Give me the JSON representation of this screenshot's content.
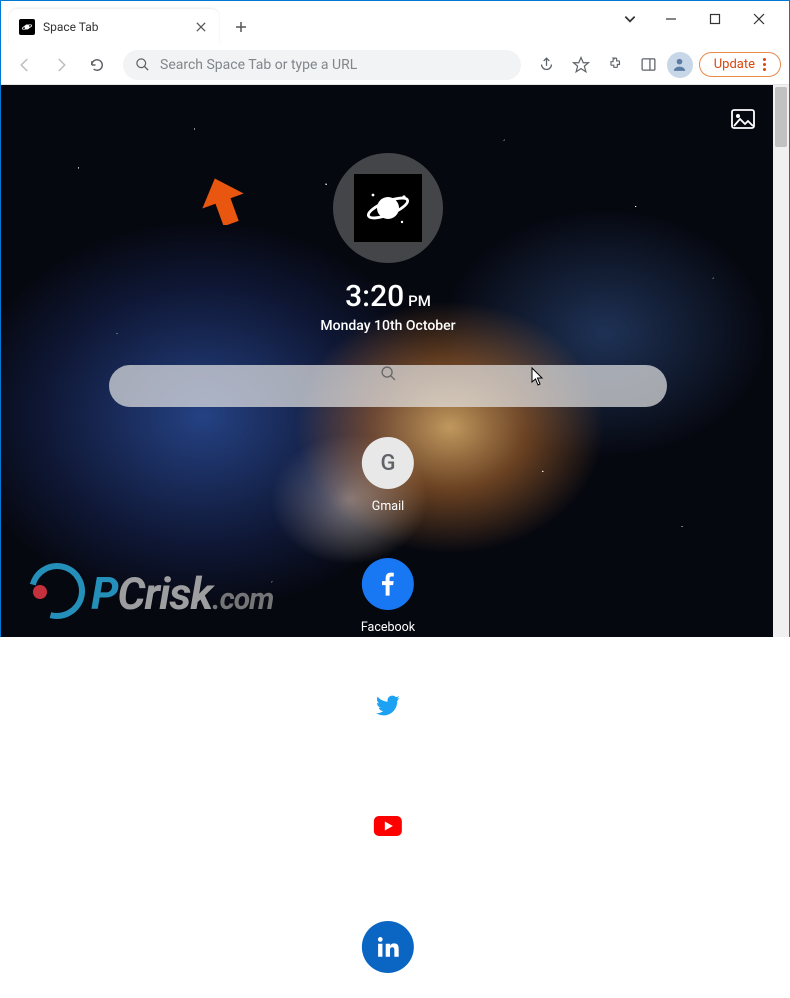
{
  "window": {
    "tab_title": "Space Tab"
  },
  "toolbar": {
    "omnibox_placeholder": "Search Space Tab or type a URL",
    "update_label": "Update"
  },
  "page": {
    "time": "3:20",
    "ampm": "PM",
    "date": "Monday 10th October",
    "shortcuts": [
      {
        "label": "Gmail",
        "icon": "gmail",
        "initial": "G"
      },
      {
        "label": "Facebook",
        "icon": "facebook"
      },
      {
        "label": "Twitter",
        "icon": "twitter"
      },
      {
        "label": "YouTube",
        "icon": "youtube"
      },
      {
        "label": "LinkedIn",
        "icon": "linkedin"
      }
    ]
  },
  "watermark": {
    "brand_a": "P",
    "brand_b": "Crisk",
    "tld": ".com"
  },
  "colors": {
    "accent_update": "#d9480f",
    "facebook": "#1877f2",
    "linkedin": "#0a66c2",
    "twitter": "#1da1f2",
    "youtube": "#ff0000",
    "watermark_blue": "#2aa8d8"
  }
}
